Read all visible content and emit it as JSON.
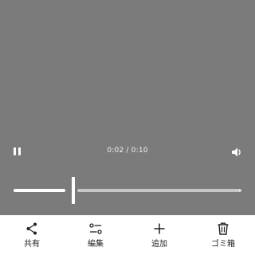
{
  "player": {
    "current_time": "0:02",
    "duration": "0:10",
    "time_display": "0:02 / 0:10",
    "progress_fraction": 0.2,
    "state": "playing"
  },
  "icons": {
    "pause": "pause-icon",
    "volume": "volume-icon",
    "share": "share-icon",
    "edit": "sliders-icon",
    "add": "plus-icon",
    "delete": "trash-icon"
  },
  "toolbar": {
    "share_label": "共有",
    "edit_label": "編集",
    "add_label": "追加",
    "delete_label": "ゴミ箱"
  },
  "colors": {
    "video_background": "#7b7b7b",
    "toolbar_background": "#ffffff",
    "progress_played": "#ffffff",
    "progress_remaining": "#c7c7c7"
  }
}
